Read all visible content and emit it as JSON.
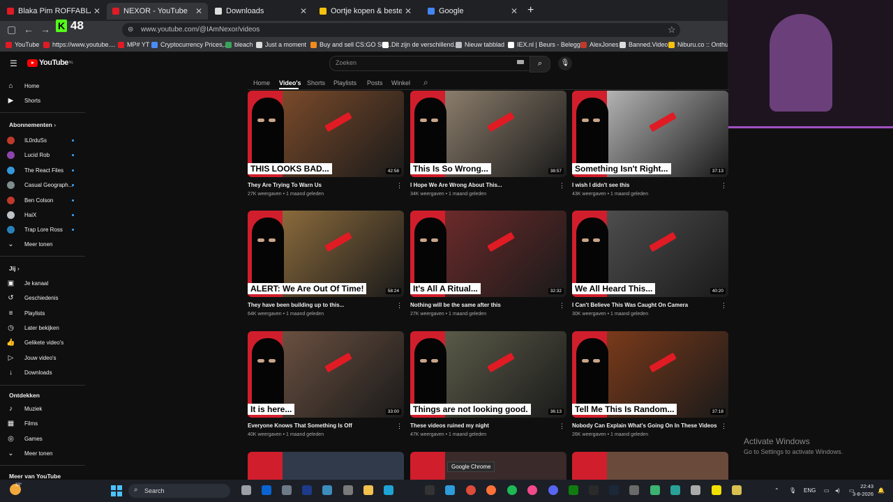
{
  "tabs": [
    {
      "title": "Blaka Pim ROFFABLAM FRE",
      "color": "#e01b24",
      "active": false
    },
    {
      "title": "NEXOR - YouTube",
      "color": "#e01b24",
      "active": true
    },
    {
      "title": "Downloads",
      "color": "#dddddd",
      "active": false
    },
    {
      "title": "Oortje kopen & bestellen | Jum",
      "color": "#f4c20d",
      "active": false
    },
    {
      "title": "Google",
      "color": "#4285f4",
      "active": false
    }
  ],
  "address": {
    "url": "www.youtube.com/@IAmNexor/videos"
  },
  "extension_badge": "48",
  "bookmarks": [
    {
      "label": "YouTube",
      "color": "#e01b24"
    },
    {
      "label": "https://www.youtube....",
      "color": "#e01b24"
    },
    {
      "label": "MP# YT",
      "color": "#e01b24"
    },
    {
      "label": "Cryptocurrency Prices,...",
      "color": "#4b8bf5"
    },
    {
      "label": "bleach",
      "color": "#3aa35b"
    },
    {
      "label": "Just a moment",
      "color": "#dddddd"
    },
    {
      "label": "Buy and sell CS:GO Ski...",
      "color": "#f28a1e"
    },
    {
      "label": "Dit zijn de verschillend...",
      "color": "#ffffff"
    },
    {
      "label": "Nieuw tabblad",
      "color": "#bdc1c6"
    },
    {
      "label": "IEX.nl | Beurs - Belegg...",
      "color": "#ffffff"
    },
    {
      "label": "AlexJones",
      "color": "#c0392b"
    },
    {
      "label": "Banned.Video",
      "color": "#dddddd"
    },
    {
      "label": "Niburu.co :: Onthulle",
      "color": "#f4c20d"
    }
  ],
  "yt": {
    "logo": "YouTube",
    "logo_sup": "NL",
    "search_placeholder": "Zoeken",
    "channel_tabs": [
      "Home",
      "Video's",
      "Shorts",
      "Playlists",
      "Posts",
      "Winkel"
    ],
    "active_tab": "Video's"
  },
  "sidebar": {
    "main": [
      {
        "label": "Home",
        "icon": "home-icon"
      },
      {
        "label": "Shorts",
        "icon": "shorts-icon"
      }
    ],
    "subs_header": "Abonnementen",
    "subs": [
      {
        "label": "IL0rduSs",
        "color": "#c0392b"
      },
      {
        "label": "Lucid Rob",
        "color": "#8e44ad"
      },
      {
        "label": "The React Files",
        "color": "#3498db"
      },
      {
        "label": "Casual Geograph...",
        "color": "#7f8c8d"
      },
      {
        "label": "Ben Colson",
        "color": "#c0392b"
      },
      {
        "label": "HaiX",
        "color": "#bdc3c7"
      },
      {
        "label": "Trap Lore Ross",
        "color": "#2980b9"
      }
    ],
    "show_more": "Meer tonen",
    "you_header": "Jij",
    "you": [
      {
        "label": "Je kanaal",
        "icon": "channel-icon"
      },
      {
        "label": "Geschiedenis",
        "icon": "history-icon"
      },
      {
        "label": "Playlists",
        "icon": "playlists-icon"
      },
      {
        "label": "Later bekijken",
        "icon": "watch-later-icon"
      },
      {
        "label": "Gelikete video's",
        "icon": "like-icon"
      },
      {
        "label": "Jouw video's",
        "icon": "your-videos-icon"
      },
      {
        "label": "Downloads",
        "icon": "download-icon"
      }
    ],
    "explore_header": "Ontdekken",
    "explore": [
      {
        "label": "Muziek",
        "icon": "music-icon"
      },
      {
        "label": "Films",
        "icon": "films-icon"
      },
      {
        "label": "Games",
        "icon": "games-icon"
      }
    ],
    "show_more2": "Meer tonen",
    "more_header": "Meer van YouTube"
  },
  "videos": [
    {
      "caption": "THIS LOOKS BAD...",
      "duration": "42:58",
      "title": "They Are Trying To Warn Us",
      "meta": "27K weergaven • 1 maand geleden",
      "scene": "#7a4a2a"
    },
    {
      "caption": "This Is So Wrong...",
      "duration": "38:57",
      "title": "I Hope We Are Wrong About This...",
      "meta": "34K weergaven • 1 maand geleden",
      "scene": "#8b7d6b"
    },
    {
      "caption": "Something Isn't Right...",
      "duration": "37:13",
      "title": "I wish I didn't see this",
      "meta": "43K weergaven • 1 maand geleden",
      "scene": "#b3b3b3"
    },
    {
      "caption": "ALERT: We Are Out Of Time!",
      "duration": "58:24",
      "title": "They have been building up to this...",
      "meta": "64K weergaven • 1 maand geleden",
      "scene": "#8a6a3c"
    },
    {
      "caption": "It's All A Ritual...",
      "duration": "32:32",
      "title": "Nothing will be the same after this",
      "meta": "27K weergaven • 1 maand geleden",
      "scene": "#6b2a2a"
    },
    {
      "caption": "We All Heard This...",
      "duration": "40:20",
      "title": "I Can't Believe This Was Caught On Camera",
      "meta": "30K weergaven • 1 maand geleden",
      "scene": "#4d4d4d"
    },
    {
      "caption": "It is here...",
      "duration": "33:00",
      "title": "Everyone Knows That Something Is Off",
      "meta": "40K weergaven • 1 maand geleden",
      "scene": "#6a5040"
    },
    {
      "caption": "Things are not looking good.",
      "duration": "36:13",
      "title": "These videos ruined my night",
      "meta": "47K weergaven • 1 maand geleden",
      "scene": "#5a5a48"
    },
    {
      "caption": "Tell Me This Is Random...",
      "duration": "37:18",
      "title": "Nobody Can Explain What's Going On In These Videos",
      "meta": "26K weergaven • 1 maand geleden",
      "scene": "#7a3a1a"
    }
  ],
  "tooltip": "Google Chrome",
  "activate": {
    "line1": "Activate Windows",
    "line2": "Go to Settings to activate Windows."
  },
  "taskbar": {
    "weather": "23°",
    "search": "Search",
    "lang": "ENG",
    "time": "22:43",
    "date": "3-8-2026"
  }
}
